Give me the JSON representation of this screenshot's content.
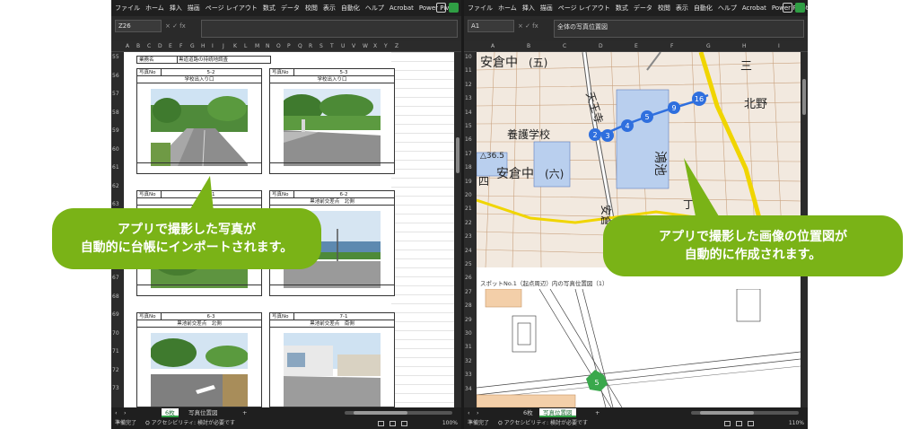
{
  "left": {
    "ribbon_tabs": [
      "ファイル",
      "ホーム",
      "挿入",
      "描画",
      "ページ レイアウト",
      "数式",
      "データ",
      "校閲",
      "表示",
      "自動化",
      "ヘルプ",
      "Acrobat",
      "Power Pivot"
    ],
    "name_box": "Z26",
    "formula_icons": "× ✓ fx",
    "formula_value": "",
    "columns": [
      "A",
      "B",
      "C",
      "D",
      "E",
      "F",
      "G",
      "H",
      "I",
      "J",
      "K",
      "L",
      "M",
      "N",
      "O",
      "P",
      "Q",
      "R",
      "S",
      "T",
      "U",
      "V",
      "W",
      "X",
      "Y",
      "Z"
    ],
    "rows": [
      "55",
      "56",
      "57",
      "58",
      "59",
      "60",
      "61",
      "62",
      "63",
      "64",
      "65",
      "66",
      "67",
      "68",
      "69",
      "70",
      "71",
      "72",
      "73"
    ],
    "top_label": "業務名",
    "top_value": "黒道道路の持続地調査",
    "records": [
      {
        "label": "写真No",
        "number": "5-2",
        "caption": "学校出入り口"
      },
      {
        "label": "写真No",
        "number": "5-3",
        "caption": "学校出入り口"
      },
      {
        "label": "写真No",
        "number": "6-1",
        "caption": ""
      },
      {
        "label": "写真No",
        "number": "6-2",
        "caption": "黒池前交差点　北側"
      },
      {
        "label": "写真No",
        "number": "6-3",
        "caption": "黒池前交差点　北側"
      },
      {
        "label": "写真No",
        "number": "7-1",
        "caption": "黒池前交差点　南側"
      }
    ],
    "sheet_tabs": [
      "6枚",
      "写真位置図"
    ],
    "add_sheet": "+",
    "status_ready": "準備完了",
    "status_access": "アクセシビリティ: 検討が必要です",
    "zoom": "100%"
  },
  "right": {
    "ribbon_tabs": [
      "ファイル",
      "ホーム",
      "挿入",
      "描画",
      "ページ レイアウト",
      "数式",
      "データ",
      "校閲",
      "表示",
      "自動化",
      "ヘルプ",
      "Acrobat",
      "Power Pivot"
    ],
    "name_box": "A1",
    "formula_icons": "× ✓ fx",
    "formula_value": "全体の写真位置図",
    "columns": [
      "A",
      "B",
      "C",
      "D",
      "E",
      "F",
      "G",
      "H",
      "I"
    ],
    "rows": [
      "10",
      "11",
      "12",
      "13",
      "14",
      "15",
      "16",
      "17",
      "18",
      "19",
      "20",
      "21",
      "22",
      "23",
      "24",
      "25",
      "26",
      "27",
      "28",
      "29",
      "30",
      "31",
      "32",
      "33",
      "34"
    ],
    "map_labels": [
      "安倉中",
      "(五)",
      "天王寺",
      "養護学校",
      "鴻池",
      "安倉中",
      "(六)",
      "四",
      "安倉",
      "北野",
      "三",
      "丁",
      "△36.5"
    ],
    "markers": [
      "2",
      "3",
      "4",
      "5",
      "9",
      "16"
    ],
    "caption": "スポットNo.1（起点周辺）内の写真位置図（1）",
    "bottom_marker": "5",
    "sheet_tabs": [
      "6枚",
      "写真位置図"
    ],
    "add_sheet": "+",
    "status_ready": "準備完了",
    "status_access": "アクセシビリティ: 検討が必要です",
    "zoom": "110%"
  },
  "callouts": {
    "left": {
      "line1": "アプリで撮影した写真が",
      "line2": "自動的に台帳にインポートされます。"
    },
    "right": {
      "line1": "アプリで撮影した画像の位置図が",
      "line2": "自動的に作成されます。"
    }
  },
  "colors": {
    "callout_green": "#7ab317",
    "excel_dark": "#1f1f1f",
    "accent_green": "#2f9e44",
    "map_blue": "#2f6fde"
  }
}
